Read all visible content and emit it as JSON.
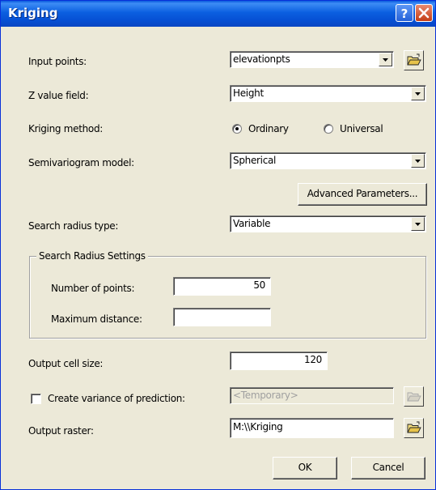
{
  "window": {
    "title": "Kriging"
  },
  "fields": {
    "input_points": {
      "label": "Input points:",
      "value": "elevationpts"
    },
    "z_value": {
      "label": "Z value field:",
      "value": "Height"
    },
    "kriging_method": {
      "label": "Kriging method:",
      "ordinary": "Ordinary",
      "universal": "Universal",
      "selected": "Ordinary"
    },
    "semivariogram": {
      "label": "Semivariogram model:",
      "value": "Spherical"
    },
    "advanced_button": "Advanced Parameters...",
    "search_radius_type": {
      "label": "Search radius type:",
      "value": "Variable"
    },
    "search_settings": {
      "title": "Search Radius Settings",
      "num_points_label": "Number of points:",
      "num_points_value": "50",
      "max_distance_label": "Maximum distance:",
      "max_distance_value": ""
    },
    "output_cell_size": {
      "label": "Output cell size:",
      "value": "120"
    },
    "variance": {
      "label": "Create variance of prediction:",
      "checked": false,
      "placeholder": "<Temporary>"
    },
    "output_raster": {
      "label": "Output raster:",
      "value": "M:\\\\Kriging"
    }
  },
  "buttons": {
    "ok": "OK",
    "cancel": "Cancel"
  },
  "colors": {
    "titlebar": "#0a5bdc",
    "face": "#ece9d8"
  },
  "icons": {
    "help": "question-mark-icon",
    "close": "close-x-icon",
    "browse": "open-folder-icon",
    "dropdown": "chevron-down-icon"
  }
}
